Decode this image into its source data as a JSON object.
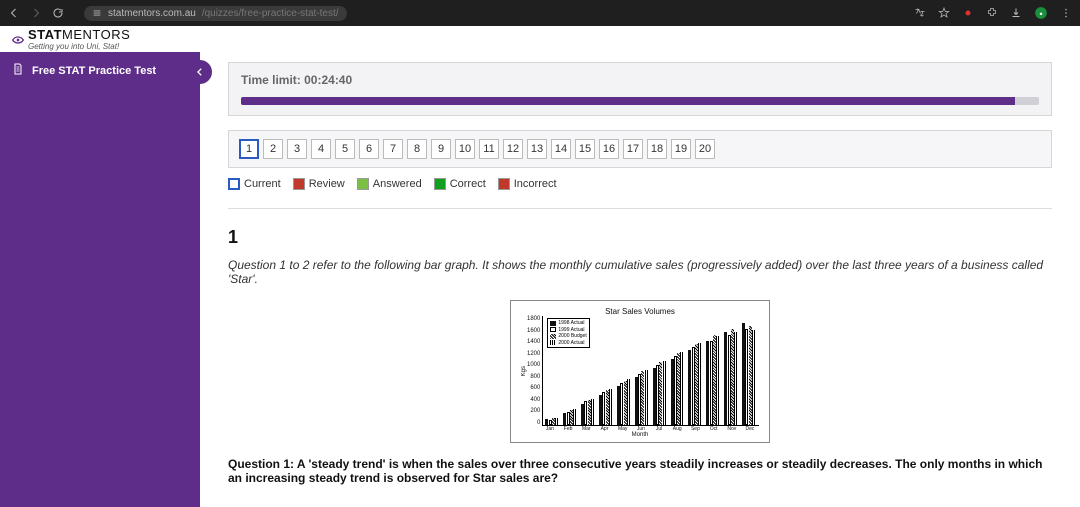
{
  "browser": {
    "url_host": "statmentors.com.au",
    "url_path": "/quizzes/free-practice-stat-test/"
  },
  "brand": {
    "name_bold": "STAT",
    "name_light": "MENTORS",
    "tagline": "Getting you into Uni, Stat!"
  },
  "sidebar": {
    "item_label": "Free STAT Practice Test"
  },
  "timer": {
    "label": "Time limit: 00:24:40"
  },
  "qnav": {
    "items": [
      "1",
      "2",
      "3",
      "4",
      "5",
      "6",
      "7",
      "8",
      "9",
      "10",
      "11",
      "12",
      "13",
      "14",
      "15",
      "16",
      "17",
      "18",
      "19",
      "20"
    ],
    "current_index": 0
  },
  "legend": {
    "current": "Current",
    "review": "Review",
    "answered": "Answered",
    "correct": "Correct",
    "incorrect": "Incorrect"
  },
  "question": {
    "number": "1",
    "context": "Question 1 to 2 refer to the following bar graph. It shows the monthly cumulative sales (progressively added) over the last three years of a business called 'Star'.",
    "prompt": "Question 1: A 'steady trend' is when the sales over three consecutive years steadily increases or steadily decreases. The only months in which an increasing steady trend is observed for Star sales are?"
  },
  "chart_data": {
    "type": "bar",
    "title": "Star Sales Volumes",
    "xlabel": "Month",
    "ylabel": "Kgs",
    "ylim": [
      0,
      1800
    ],
    "yticks": [
      "1800",
      "1600",
      "1400",
      "1200",
      "1000",
      "800",
      "600",
      "400",
      "200",
      "0"
    ],
    "categories": [
      "Jan",
      "Feb",
      "Mar",
      "Apr",
      "May",
      "Jun",
      "Jul",
      "Aug",
      "Sep",
      "Oct",
      "Nov",
      "Dec"
    ],
    "series": [
      {
        "name": "1998 Actual",
        "values": [
          100,
          200,
          350,
          500,
          650,
          800,
          950,
          1100,
          1250,
          1400,
          1550,
          1700
        ]
      },
      {
        "name": "1999 Actual",
        "values": [
          90,
          220,
          400,
          550,
          700,
          850,
          1000,
          1150,
          1300,
          1400,
          1500,
          1600
        ]
      },
      {
        "name": "2000 Budget",
        "values": [
          110,
          250,
          420,
          580,
          740,
          900,
          1050,
          1200,
          1350,
          1500,
          1600,
          1650
        ]
      },
      {
        "name": "2000 Actual",
        "values": [
          120,
          260,
          430,
          600,
          760,
          920,
          1070,
          1220,
          1360,
          1480,
          1550,
          1580
        ]
      }
    ]
  }
}
